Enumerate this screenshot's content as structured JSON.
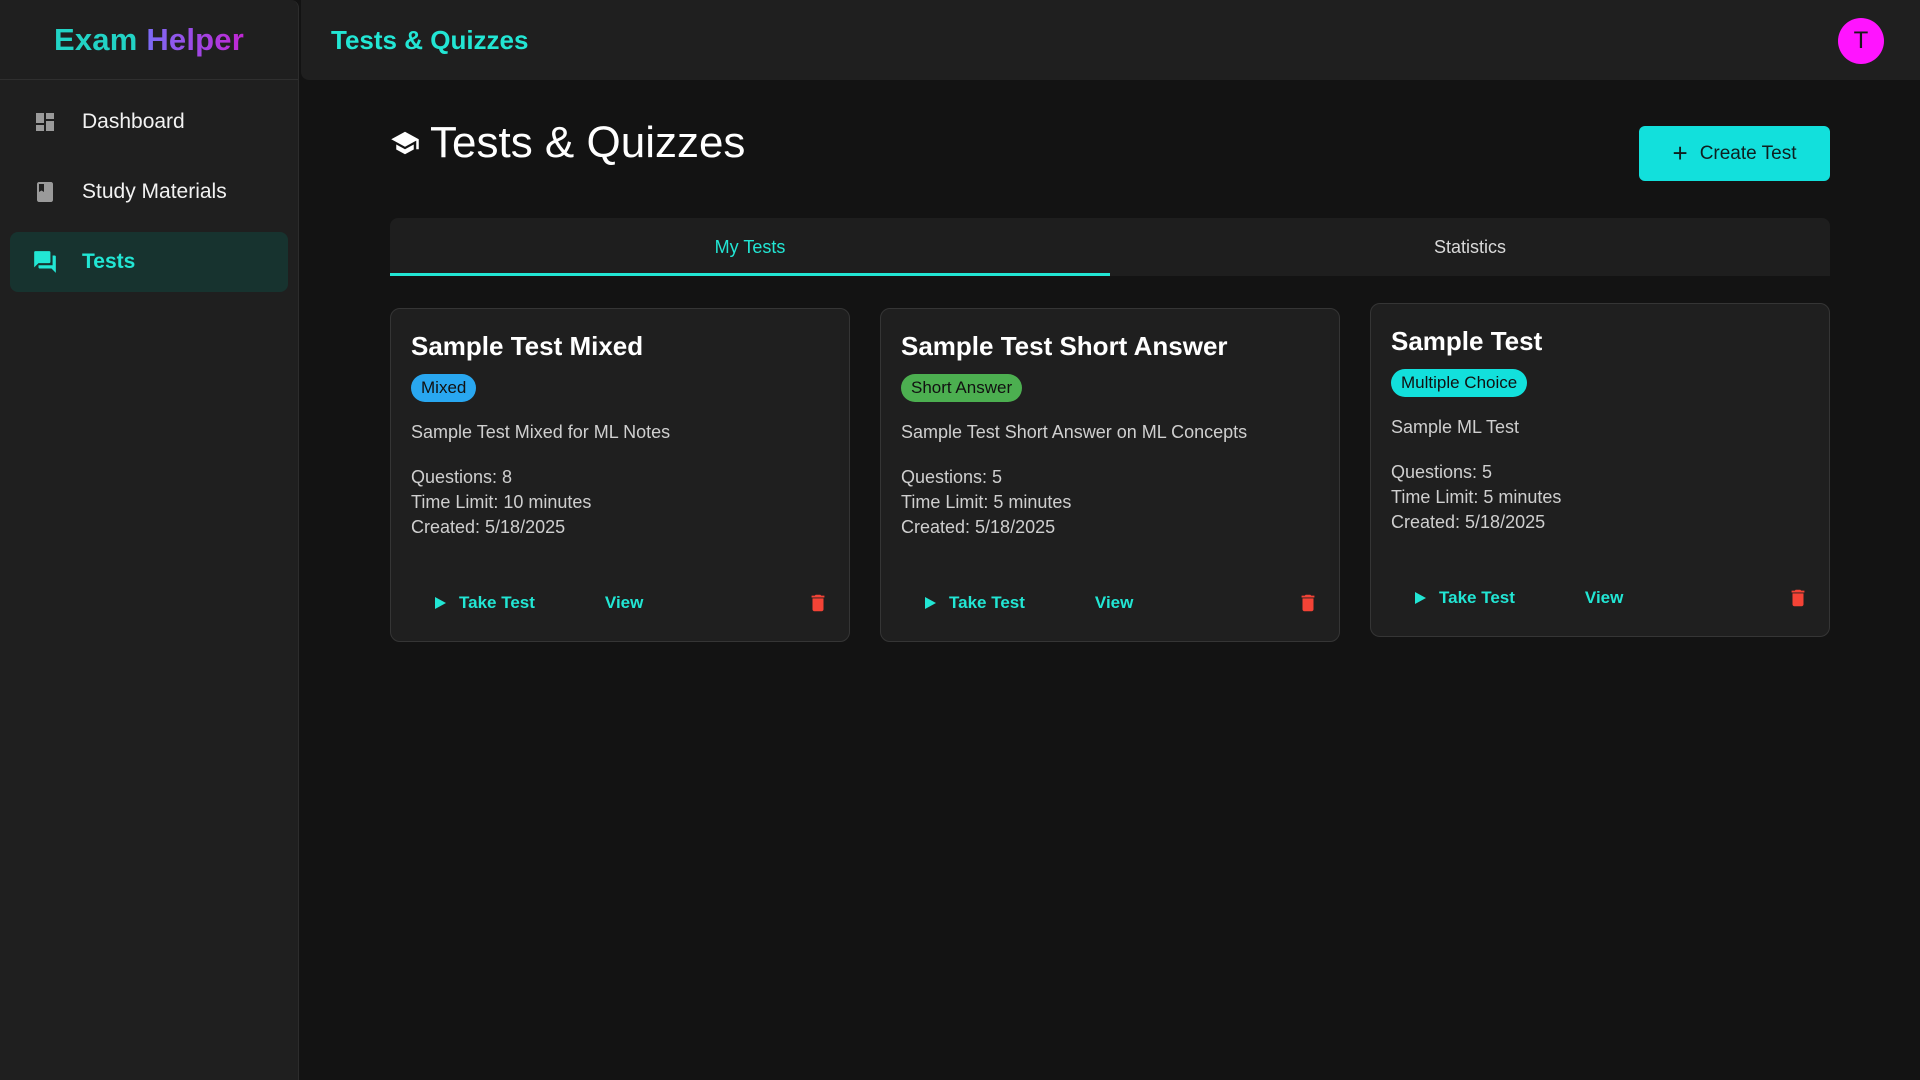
{
  "brand": {
    "part1": "Exam",
    "part2": "Helper"
  },
  "sidebar": {
    "items": [
      {
        "label": "Dashboard",
        "icon": "dashboard-icon"
      },
      {
        "label": "Study Materials",
        "icon": "book-icon"
      },
      {
        "label": "Tests",
        "icon": "forum-icon",
        "active": true
      }
    ]
  },
  "header": {
    "title": "Tests & Quizzes",
    "avatar_letter": "T"
  },
  "main": {
    "title": "Tests & Quizzes",
    "title_icon": "graduation-cap-icon",
    "create_label": "Create Test",
    "tabs": [
      {
        "label": "My Tests",
        "active": true
      },
      {
        "label": "Statistics",
        "active": false
      }
    ],
    "cards": [
      {
        "title": "Sample Test Mixed",
        "badge": "Mixed",
        "badge_color": "#29a7f0",
        "description": "Sample Test Mixed for ML Notes",
        "questions": "Questions: 8",
        "time_limit": "Time Limit: 10 minutes",
        "created": "Created: 5/18/2025",
        "take_label": "Take Test",
        "view_label": "View"
      },
      {
        "title": "Sample Test Short Answer",
        "badge": "Short Answer",
        "badge_color": "#4caf50",
        "description": "Sample Test Short Answer on ML Concepts",
        "questions": "Questions: 5",
        "time_limit": "Time Limit: 5 minutes",
        "created": "Created: 5/18/2025",
        "take_label": "Take Test",
        "view_label": "View"
      },
      {
        "title": "Sample Test",
        "badge": "Multiple Choice",
        "badge_color": "#12e0dc",
        "description": "Sample ML Test",
        "questions": "Questions: 5",
        "time_limit": "Time Limit: 5 minutes",
        "created": "Created: 5/18/2025",
        "take_label": "Take Test",
        "view_label": "View"
      }
    ]
  },
  "colors": {
    "accent": "#22e6d4",
    "danger": "#f44336",
    "avatar": "#ff14ff"
  }
}
